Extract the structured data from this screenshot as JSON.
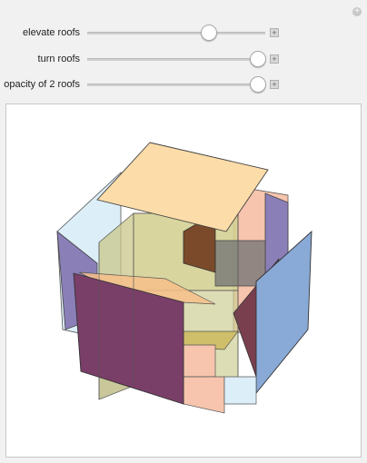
{
  "controls": [
    {
      "label": "elevate roofs",
      "value": 0.7
    },
    {
      "label": "turn roofs",
      "value": 0.96
    },
    {
      "label": "opacity of 2 roofs",
      "value": 0.96
    }
  ],
  "icons": {
    "corner": "plus-circle-icon",
    "expand": "plus-square-icon"
  },
  "colors": {
    "roof_peach": "#fcdca8",
    "face_lightblue": "#dceef8",
    "face_purple": "#8b7fb8",
    "face_maroon": "#7a3f68",
    "face_blue": "#89a9d6",
    "face_pink": "#f7c4ad",
    "cube_yellow": "#c9c78a",
    "brown": "#7a4a2a"
  }
}
